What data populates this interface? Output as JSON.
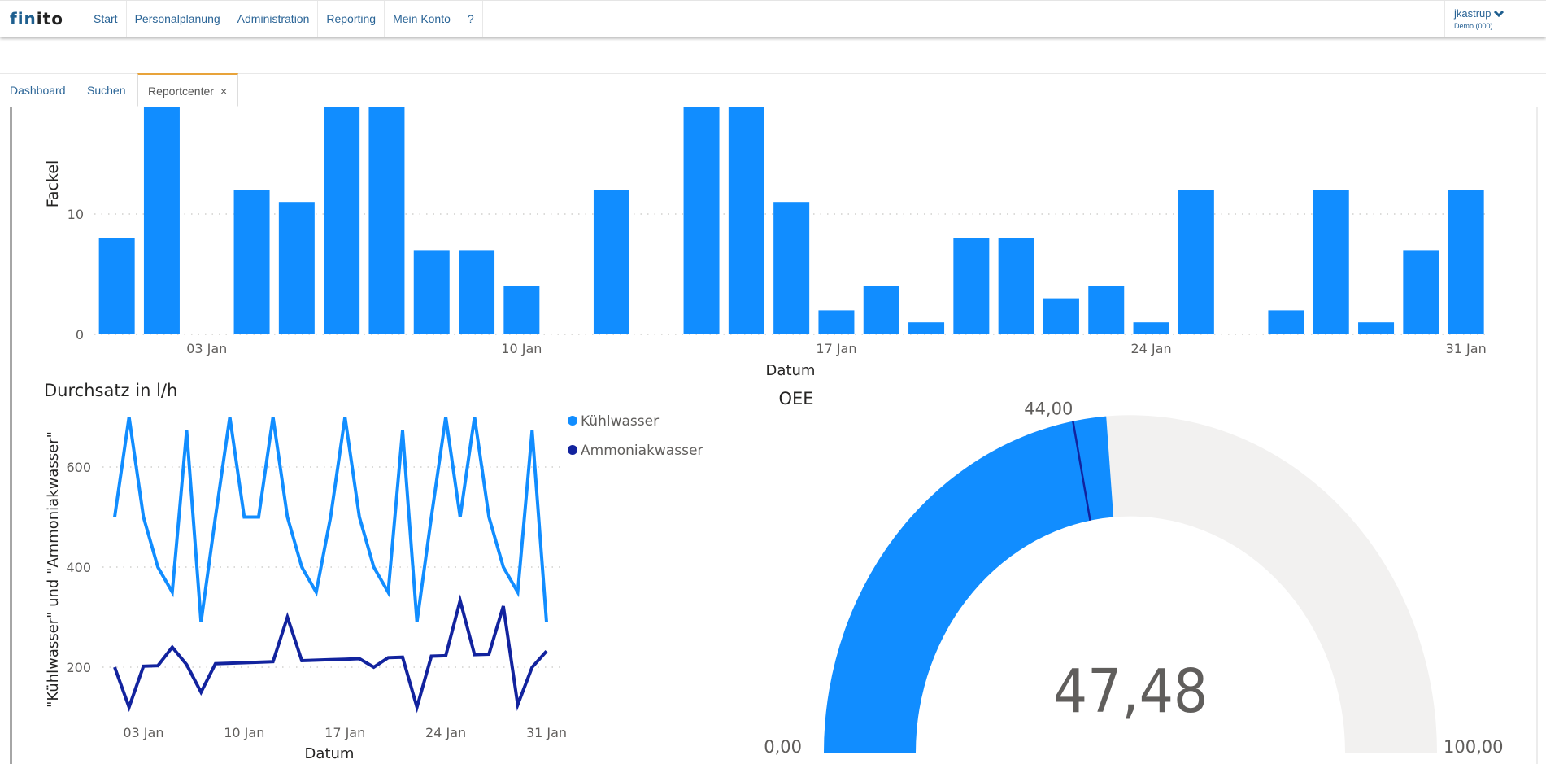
{
  "app": {
    "logo_part1": "fin",
    "logo_part2": "ito",
    "nav": [
      "Start",
      "Personalplanung",
      "Administration",
      "Reporting",
      "Mein Konto",
      "?"
    ],
    "user": {
      "name": "jkastrup",
      "tenant": "Demo (000)",
      "menu_icon": "chevron-down-icon"
    }
  },
  "tabs": [
    {
      "label": "Dashboard",
      "active": false
    },
    {
      "label": "Suchen",
      "active": false
    },
    {
      "label": "Reportcenter",
      "active": true,
      "close": "×"
    }
  ],
  "chart_data": [
    {
      "type": "bar",
      "title": "",
      "ylabel": "Fackel",
      "xlabel": "Datum",
      "ylim": [
        0,
        19
      ],
      "yticks": [
        0,
        10
      ],
      "grid": true,
      "color": "#118dff",
      "xtick_labels": [
        {
          "day": 3,
          "label": "03 Jan"
        },
        {
          "day": 10,
          "label": "10 Jan"
        },
        {
          "day": 17,
          "label": "17 Jan"
        },
        {
          "day": 24,
          "label": "24 Jan"
        },
        {
          "day": 31,
          "label": "31 Jan"
        }
      ],
      "categories": [
        1,
        2,
        3,
        4,
        5,
        6,
        7,
        8,
        9,
        10,
        11,
        12,
        13,
        14,
        15,
        16,
        17,
        18,
        19,
        20,
        21,
        22,
        23,
        24,
        25,
        26,
        27,
        28,
        29,
        30,
        31
      ],
      "values": [
        8,
        19,
        0,
        12,
        11,
        19,
        19,
        7,
        7,
        4,
        0,
        12,
        0,
        19,
        19,
        11,
        2,
        4,
        1,
        8,
        8,
        3,
        4,
        1,
        12,
        0,
        2,
        12,
        1,
        7,
        12
      ]
    },
    {
      "type": "line",
      "title": "Durchsatz in l/h",
      "ylabel": "\"Kühlwasser\" und \"Ammoniakwasser\"",
      "xlabel": "Datum",
      "ylim": [
        100,
        720
      ],
      "yticks": [
        200,
        400,
        600
      ],
      "grid": true,
      "legend": "right",
      "xtick_labels": [
        {
          "day": 3,
          "label": "03 Jan"
        },
        {
          "day": 10,
          "label": "10 Jan"
        },
        {
          "day": 17,
          "label": "17 Jan"
        },
        {
          "day": 24,
          "label": "24 Jan"
        },
        {
          "day": 31,
          "label": "31 Jan"
        }
      ],
      "x": [
        1,
        2,
        3,
        4,
        5,
        6,
        7,
        8,
        9,
        10,
        11,
        12,
        13,
        14,
        15,
        16,
        17,
        18,
        19,
        20,
        21,
        22,
        23,
        24,
        25,
        26,
        27,
        28,
        29,
        30,
        31
      ],
      "series": [
        {
          "name": "Kühlwasser",
          "color": "#118dff",
          "values": [
            500,
            700,
            500,
            400,
            350,
            673,
            290,
            500,
            700,
            500,
            500,
            700,
            500,
            400,
            350,
            500,
            700,
            500,
            400,
            350,
            673,
            290,
            500,
            700,
            500,
            700,
            500,
            400,
            350,
            673,
            290
          ]
        },
        {
          "name": "Ammoniakwasser",
          "color": "#12239e",
          "values": [
            200,
            120,
            202,
            203,
            240,
            205,
            150,
            207,
            208,
            209,
            210,
            211,
            300,
            213,
            214,
            215,
            216,
            217,
            200,
            219,
            220,
            120,
            222,
            223,
            333,
            225,
            226,
            322,
            125,
            200,
            232
          ]
        }
      ]
    },
    {
      "type": "gauge",
      "title": "OEE",
      "value": 47.48,
      "value_label": "47,48",
      "target": 44.0,
      "target_label": "44,00",
      "min": 0,
      "min_label": "0,00",
      "max": 100,
      "max_label": "100,00",
      "fill_color": "#118dff",
      "track_color": "#f2f1f0",
      "target_color": "#12239e"
    }
  ]
}
